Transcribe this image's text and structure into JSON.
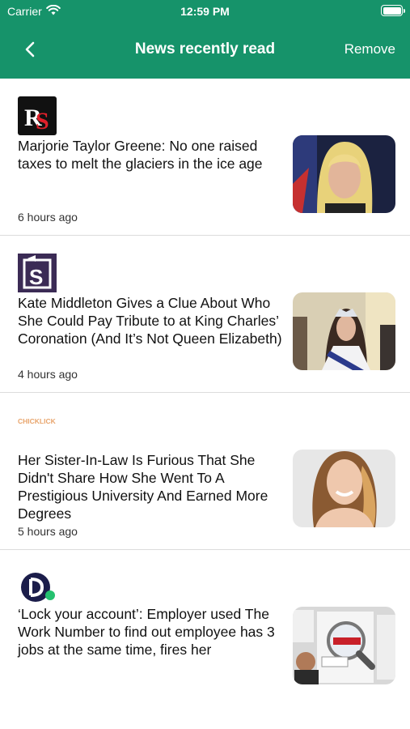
{
  "status": {
    "carrier": "Carrier",
    "time": "12:59 PM"
  },
  "nav": {
    "title": "News recently read",
    "remove_label": "Remove"
  },
  "colors": {
    "accent": "#16936a"
  },
  "articles": [
    {
      "headline": "Marjorie Taylor Greene: No one raised taxes to melt the glaciers in the ice age",
      "ago": "6 hours ago",
      "logo_icon": "rs-logo-icon"
    },
    {
      "headline": "Kate Middleton Gives a Clue About Who She Could Pay Tribute to at King Charles’ Coronation (And It’s Not Queen Elizabeth)",
      "ago": "4 hours ago",
      "logo_icon": "s-logo-icon"
    },
    {
      "headline": "Her Sister-In-Law Is Furious That She Didn't Share How She Went To A Prestigious University And Earned More Degrees",
      "ago": "5 hours ago",
      "logo_icon": "chicklick-logo-icon",
      "logo_text": "CHICKLICK"
    },
    {
      "headline": "‘Lock your account’: Employer used The Work Number to find out employee has 3 jobs at the same time, fires her",
      "ago": "",
      "logo_icon": "d-logo-icon"
    }
  ]
}
